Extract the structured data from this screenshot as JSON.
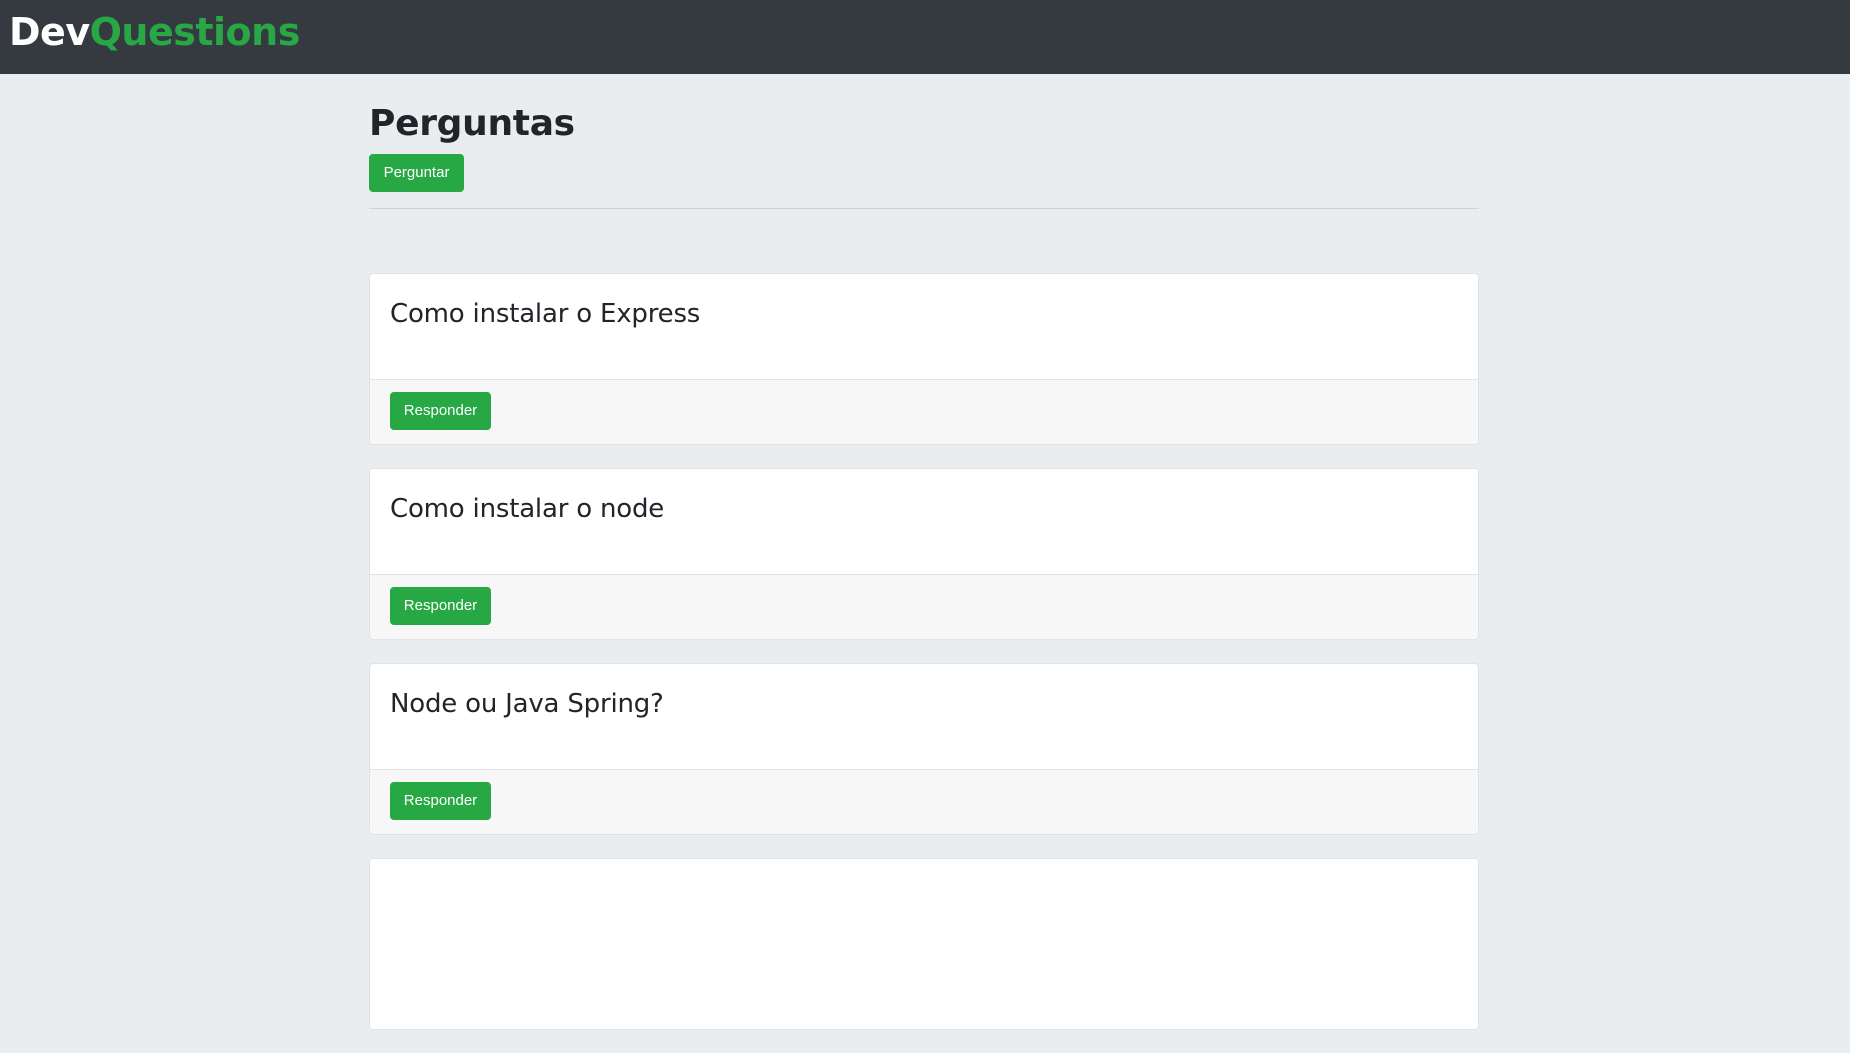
{
  "navbar": {
    "brand_dev": "Dev",
    "brand_questions": "Questions"
  },
  "main": {
    "title": "Perguntas",
    "ask_button_label": "Perguntar"
  },
  "questions": [
    {
      "title": "Como instalar o Express",
      "answer_label": "Responder"
    },
    {
      "title": "Como instalar o node",
      "answer_label": "Responder"
    },
    {
      "title": "Node ou Java Spring?",
      "answer_label": "Responder"
    }
  ],
  "colors": {
    "navbar_bg": "#343a40",
    "brand_accent": "#28a745",
    "page_bg": "#eaedf0",
    "button_success": "#28a745",
    "card_footer_bg": "#f7f7f7"
  }
}
